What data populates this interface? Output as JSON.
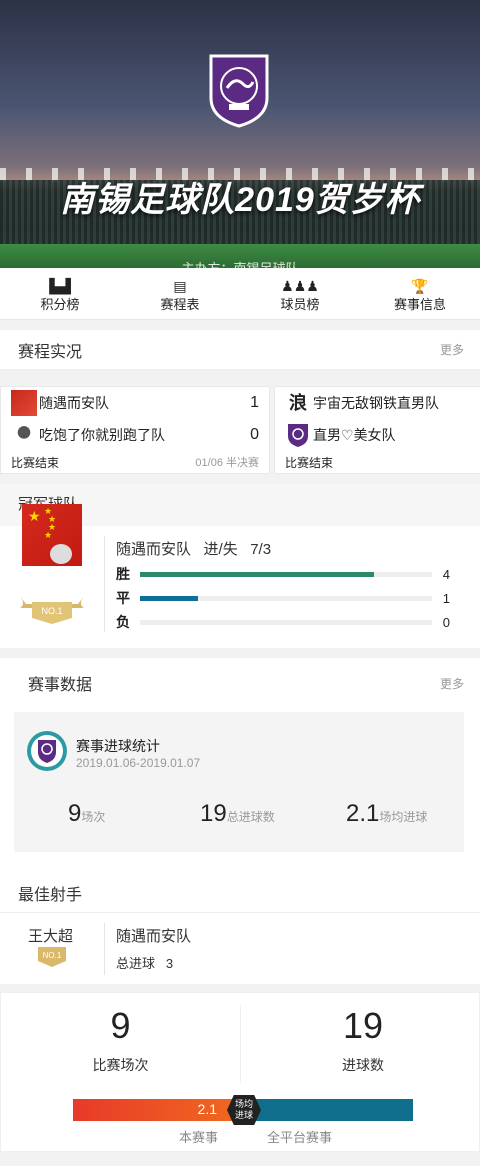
{
  "banner": {
    "title": "南锡足球队2019贺岁杯",
    "host": "主办方：南锡足球队"
  },
  "nav": [
    {
      "label": "积分榜",
      "icon": "rank-icon"
    },
    {
      "label": "赛程表",
      "icon": "calendar-icon"
    },
    {
      "label": "球员榜",
      "icon": "players-icon"
    },
    {
      "label": "赛事信息",
      "icon": "trophy-icon"
    }
  ],
  "schedule": {
    "title": "赛程实况",
    "more": "更多",
    "matches": [
      {
        "home": "随遇而安队",
        "home_score": "1",
        "away": "吃饱了你就别跑了队",
        "away_score": "0",
        "status": "比赛结束",
        "date": "01/06 半决赛"
      },
      {
        "home": "宇宙无敌钢铁直男队",
        "home_logo_text": "浪",
        "away": "直男♡美女队",
        "status": "比赛结束"
      }
    ]
  },
  "champion": {
    "title": "冠军球队",
    "team": "随遇而安队",
    "goals_label": "进/失",
    "goals": "7/3",
    "medal": "NO.1",
    "win_label": "胜",
    "win": 4,
    "draw_label": "平",
    "draw": 1,
    "loss_label": "负",
    "loss": 0,
    "colors": {
      "win": "#2e8a66",
      "draw": "#106f96"
    }
  },
  "stats": {
    "title": "赛事数据",
    "more": "更多",
    "box_title": "赛事进球统计",
    "date_range": "2019.01.06-2019.01.07",
    "matches": "9",
    "matches_unit": "场次",
    "goals": "19",
    "goals_unit": "总进球数",
    "avg": "2.1",
    "avg_unit": "场均进球"
  },
  "best": {
    "title": "最佳射手",
    "player": "王大超",
    "medal": "NO.1",
    "team": "随遇而安队",
    "goals_label": "总进球",
    "goals": "3"
  },
  "summary": {
    "matches": "9",
    "matches_label": "比赛场次",
    "goals": "19",
    "goals_label": "进球数",
    "avg": "2.1",
    "hex_label_1": "场均",
    "hex_label_2": "进球",
    "this_label": "本赛事",
    "all_label": "全平台赛事"
  }
}
